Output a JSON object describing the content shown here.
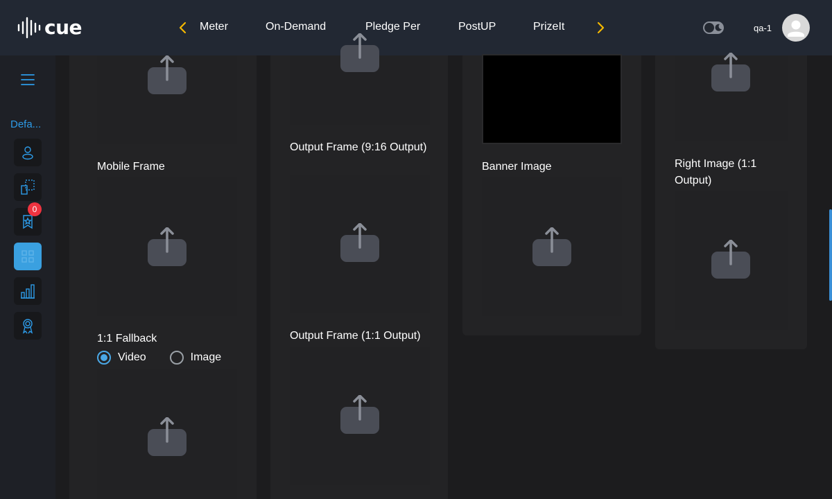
{
  "header": {
    "logo_text": "cue",
    "nav": [
      "Meter",
      "On-Demand",
      "Pledge Per",
      "PostUP",
      "PrizeIt"
    ],
    "username": "qa-1",
    "accent": "#f5b800"
  },
  "sidebar": {
    "label": "Defa...",
    "badge_count": "0",
    "items": [
      "user-icon",
      "layout-icon",
      "award-star-icon",
      "grid-icon",
      "bar-chart-icon",
      "medal-icon"
    ],
    "active_item": "grid-icon",
    "accent": "#2d9be8"
  },
  "col1": {
    "mobile_frame_label": "Mobile Frame",
    "fallback_label": "1:1 Fallback",
    "radio_video": "Video",
    "radio_image": "Image",
    "selected": "Video"
  },
  "col2": {
    "output_916_label": "Output Frame (9:16 Output)",
    "output_11_label": "Output Frame (1:1 Output)"
  },
  "col3": {
    "banner_label": "Banner Image"
  },
  "col4": {
    "right_image_label": "Right Image (1:1 Output)"
  }
}
